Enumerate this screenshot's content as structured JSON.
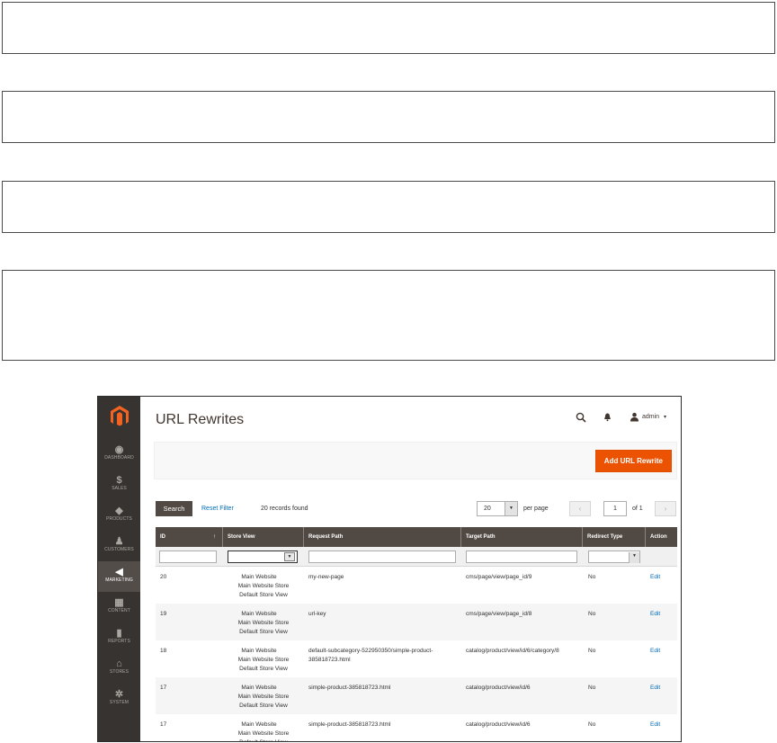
{
  "app": {
    "page_title": "URL Rewrites",
    "user_name": "admin",
    "user_caret": "▾",
    "add_button": "Add URL Rewrite",
    "logo": "magento-logo-icon"
  },
  "sidebar": {
    "items": [
      {
        "label": "DASHBOARD",
        "icon": "dashboard-icon",
        "glyph": "◉"
      },
      {
        "label": "SALES",
        "icon": "dollar-icon",
        "glyph": "$"
      },
      {
        "label": "PRODUCTS",
        "icon": "box-icon",
        "glyph": "◆"
      },
      {
        "label": "CUSTOMERS",
        "icon": "person-icon",
        "glyph": "♟"
      },
      {
        "label": "MARKETING",
        "icon": "megaphone-icon",
        "glyph": "◀"
      },
      {
        "label": "CONTENT",
        "icon": "layout-icon",
        "glyph": "▦"
      },
      {
        "label": "REPORTS",
        "icon": "bar-chart-icon",
        "glyph": "▮"
      },
      {
        "label": "STORES",
        "icon": "store-icon",
        "glyph": "⌂"
      },
      {
        "label": "SYSTEM",
        "icon": "gear-icon",
        "glyph": "✲"
      }
    ]
  },
  "toolbar": {
    "search_label": "Search",
    "reset_filter": "Reset Filter",
    "records_found": "20 records found",
    "per_page_value": "20",
    "per_page_label": "per page",
    "current_page": "1",
    "page_of": "of 1",
    "prev": "‹",
    "next": "›",
    "select_caret": "▼"
  },
  "grid": {
    "columns": [
      "ID",
      "Store View",
      "Request Path",
      "Target Path",
      "Redirect Type",
      "Action"
    ],
    "sort_indicator": "↑",
    "rows": [
      {
        "id": "20",
        "store": [
          "Main Website",
          "Main Website Store",
          "Default Store View"
        ],
        "request": [
          "my-new-page"
        ],
        "target": "cms/page/view/page_id/9",
        "redirect": "No",
        "action": "Edit"
      },
      {
        "id": "19",
        "store": [
          "Main Website",
          "Main Website Store",
          "Default Store View"
        ],
        "request": [
          "url-key"
        ],
        "target": "cms/page/view/page_id/8",
        "redirect": "No",
        "action": "Edit"
      },
      {
        "id": "18",
        "store": [
          "Main Website",
          "Main Website Store",
          "Default Store View"
        ],
        "request": [
          "default-subcategory-522950350/simple-product-",
          "385818723.html"
        ],
        "target": "catalog/product/view/id/6/category/8",
        "redirect": "No",
        "action": "Edit"
      },
      {
        "id": "17",
        "store": [
          "Main Website",
          "Main Website Store",
          "Default Store View"
        ],
        "request": [
          "simple-product-385818723.html"
        ],
        "target": "catalog/product/view/id/6",
        "redirect": "No",
        "action": "Edit"
      },
      {
        "id": "17",
        "store": [
          "Main Website",
          "Main Website Store",
          "Default Store View"
        ],
        "request": [
          "simple-product-385818723.html"
        ],
        "target": "catalog/product/view/id/6",
        "redirect": "No",
        "action": "Edit"
      }
    ]
  }
}
